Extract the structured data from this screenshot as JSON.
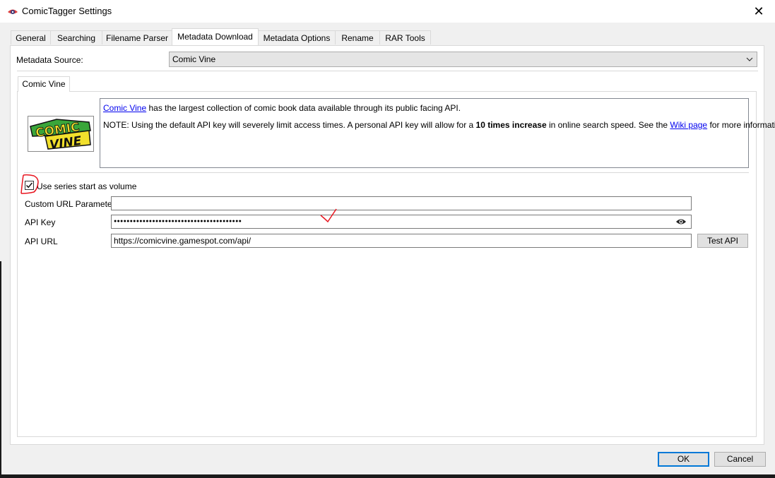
{
  "window": {
    "title": "ComicTagger Settings",
    "close_glyph": "✕"
  },
  "tabs": [
    {
      "label": "General"
    },
    {
      "label": "Searching"
    },
    {
      "label": "Filename Parser"
    },
    {
      "label": "Metadata Download",
      "active": true
    },
    {
      "label": "Metadata Options"
    },
    {
      "label": "Rename"
    },
    {
      "label": "RAR Tools"
    }
  ],
  "metadata_source": {
    "label": "Metadata Source:",
    "value": "Comic Vine"
  },
  "source_tab": {
    "label": "Comic Vine"
  },
  "logo": {
    "line1": "COMIC",
    "line2": "VINE",
    "colors": {
      "green": "#3aa63a",
      "yellow": "#f2e02c",
      "black": "#111111"
    }
  },
  "info": {
    "link_name": "Comic Vine",
    "line1_rest": " has the largest collection of comic book data available through its public facing API.",
    "line2_pre": "NOTE: Using the default API key will severely limit access times. A personal API key will allow for a ",
    "line2_bold": "10 times increase",
    "line2_mid": " in online search speed. See the ",
    "line2_link": "Wiki page",
    "line2_post": " for more information."
  },
  "options": {
    "use_series_start_label": "Use series start as volume",
    "use_series_start_checked": true,
    "custom_url_label": "Custom URL Parameters",
    "custom_url_value": "",
    "api_key_label": "API Key",
    "api_key_masked": "●●●●●●●●●●●●●●●●●●●●●●●●●●●●●●●●●●●●●●●●",
    "api_url_label": "API URL",
    "api_url_value": "https://comicvine.gamespot.com/api/",
    "test_api_label": "Test API"
  },
  "footer": {
    "ok_label": "OK",
    "cancel_label": "Cancel"
  },
  "colors": {
    "accent": "#0078d7",
    "annotation": "#e8141e",
    "link": "#0000ee"
  },
  "icons": {
    "app": "comictagger-eye-icon",
    "close": "close-icon",
    "dropdown": "chevron-down-icon",
    "reveal": "eye-icon",
    "check": "checkmark-icon"
  }
}
